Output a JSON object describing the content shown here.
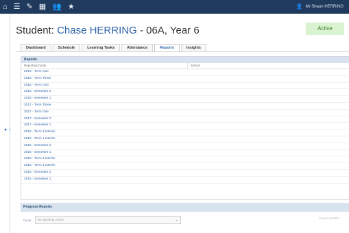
{
  "topbar": {
    "icons": [
      "home-icon",
      "list-icon",
      "edit-icon",
      "grid-icon",
      "people-icon",
      "star-icon"
    ],
    "user_name": "Mr Shaun HERRING"
  },
  "header": {
    "prefix": "Student:",
    "student_name": "Chase HERRING",
    "suffix": "- 06A, Year 6",
    "status": "Active"
  },
  "tabs": [
    "Dashboard",
    "Schedule",
    "Learning Tasks",
    "Attendance",
    "Reports",
    "Insights"
  ],
  "active_tab": "Reports",
  "reports": {
    "title": "Reports",
    "col_cycle": "Reporting Cycle",
    "col_school": "School",
    "rows": [
      "2019 - Term One",
      "2018 - Term Three",
      "2018 - Term One",
      "2018 - Semester 2",
      "2018 - Semester 1",
      "2017 - Term Three",
      "2017 - Term One",
      "2017 - Semester 2",
      "2017 - Semester 1",
      "2016 - Term 3 Interim",
      "2016 - Term 1 Interim",
      "2016 - Semester 2",
      "2016 - Semester 1",
      "2015 - Term 3 Interim",
      "2015 - Term 1 Interim",
      "2015 - Semester 2",
      "2015 - Semester 1"
    ]
  },
  "progress": {
    "title": "Progress Reports",
    "cycle_label": "Cycle:",
    "cycle_placeholder": "No reporting cycles",
    "export_label": "Export as PDF"
  }
}
